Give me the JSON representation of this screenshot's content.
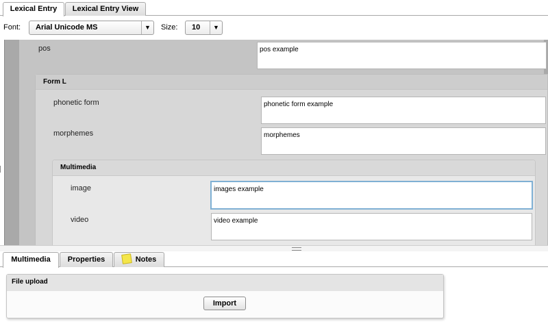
{
  "top_tabs": [
    {
      "label": "Lexical Entry",
      "active": true
    },
    {
      "label": "Lexical Entry View",
      "active": false
    }
  ],
  "toolbar": {
    "font_label": "Font:",
    "font_value": "Arial Unicode MS",
    "size_label": "Size:",
    "size_value": "10"
  },
  "editor": {
    "pos": {
      "label": "pos",
      "value": "pos example"
    },
    "form_l": {
      "title": "Form L",
      "phonetic_form": {
        "label": "phonetic form",
        "value": "phonetic form example"
      },
      "morphemes": {
        "label": "morphemes",
        "value": "morphemes"
      },
      "multimedia": {
        "title": "Multimedia",
        "image": {
          "label": "image",
          "value": "images example"
        },
        "video": {
          "label": "video",
          "value": "video example"
        }
      }
    }
  },
  "bottom_tabs": [
    {
      "label": "Multimedia",
      "active": true
    },
    {
      "label": "Properties",
      "active": false
    },
    {
      "label": "Notes",
      "active": false,
      "icon": "note-icon"
    }
  ],
  "upload": {
    "title": "File upload",
    "button_label": "Import"
  },
  "colors": {
    "outer_panel": "#a9a9a9",
    "inner_panel": "#c4c4c4",
    "form_panel": "#d7d7d7",
    "multimedia_panel": "#e8e8e8",
    "focus_border": "#7fb0d4",
    "note_icon": "#f4e64a"
  }
}
